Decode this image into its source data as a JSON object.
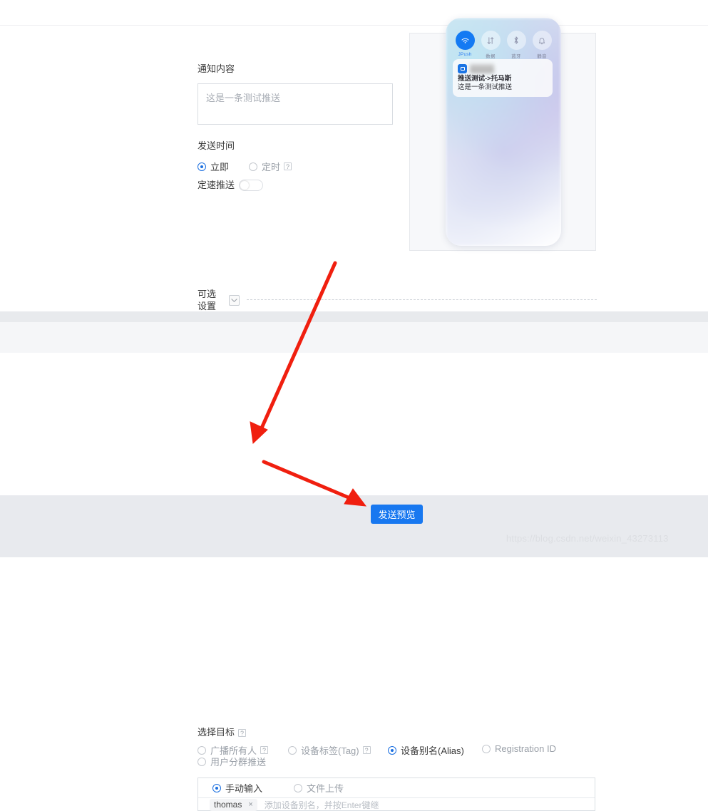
{
  "form": {
    "content_label": "通知内容",
    "content_placeholder": "这是一条测试推送",
    "time_label": "发送时间",
    "time_options": [
      {
        "label": "立即",
        "selected": true
      },
      {
        "label": "定时",
        "selected": false,
        "help": "?"
      }
    ],
    "rate_push_label": "定速推送",
    "rate_push_on": false,
    "optional_label": "可选设置",
    "collapse_icon": "chevron-down-icon"
  },
  "preview": {
    "toggles": [
      {
        "label": "JPush",
        "icon": "wifi-icon",
        "active": true
      },
      {
        "label": "数据",
        "icon": "data-transfer-icon",
        "active": false
      },
      {
        "label": "蓝牙",
        "icon": "bluetooth-icon",
        "active": false
      },
      {
        "label": "静音",
        "icon": "mute-bell-icon",
        "active": false
      }
    ],
    "notification": {
      "title": "推送测试->托马斯",
      "body": "这是一条测试推送",
      "app_icon": "jpush-app-icon"
    }
  },
  "target": {
    "label": "选择目标",
    "label_help": "?",
    "options": [
      {
        "label": "广播所有人",
        "selected": false,
        "help": "?"
      },
      {
        "label": "用户分群推送",
        "selected": false
      },
      {
        "label": "设备标签(Tag)",
        "selected": false,
        "help": "?"
      },
      {
        "label": "设备别名(Alias)",
        "selected": true
      },
      {
        "label": "Registration ID",
        "selected": false
      }
    ],
    "input_modes": [
      {
        "label": "手动输入",
        "selected": true
      },
      {
        "label": "文件上传",
        "selected": false
      }
    ],
    "chips": [
      {
        "text": "thomas",
        "remove": "×"
      }
    ],
    "alias_placeholder": "添加设备别名，并按Enter键继"
  },
  "footer": {
    "send_preview_label": "发送预览",
    "watermark": "https://blog.csdn.net/weixin_43273113"
  },
  "colors": {
    "accent": "#1878f0",
    "radio_on": "#1b6fe0",
    "annotation": "#f01f0f"
  }
}
